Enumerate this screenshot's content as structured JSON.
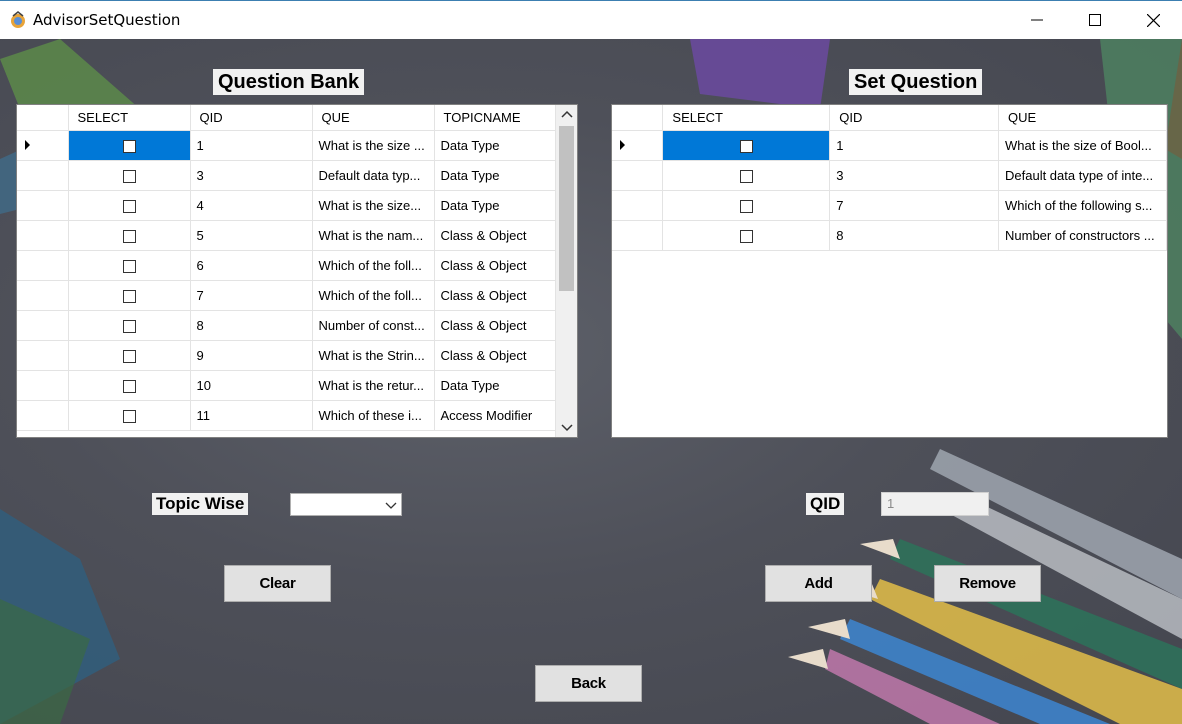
{
  "window": {
    "title": "AdvisorSetQuestion"
  },
  "question_bank": {
    "title": "Question Bank",
    "columns": [
      "SELECT",
      "QID",
      "QUE",
      "TOPICNAME"
    ],
    "rows": [
      {
        "qid": "1",
        "que": "What is the size ...",
        "topic": "Data Type"
      },
      {
        "qid": "3",
        "que": "Default data typ...",
        "topic": "Data Type"
      },
      {
        "qid": "4",
        "que": " What is the size...",
        "topic": "Data Type"
      },
      {
        "qid": "5",
        "que": "What is the nam...",
        "topic": "Class & Object"
      },
      {
        "qid": "6",
        "que": "Which of the foll...",
        "topic": "Class & Object"
      },
      {
        "qid": "7",
        "que": "Which of the foll...",
        "topic": "Class & Object"
      },
      {
        "qid": "8",
        "que": "Number of const...",
        "topic": "Class & Object"
      },
      {
        "qid": "9",
        "que": "What is the Strin...",
        "topic": "Class & Object"
      },
      {
        "qid": "10",
        "que": "What is the retur...",
        "topic": "Data Type"
      },
      {
        "qid": "11",
        "que": "Which of these i...",
        "topic": "Access Modifier"
      }
    ]
  },
  "set_question": {
    "title": "Set Question",
    "columns": [
      "SELECT",
      "QID",
      "QUE"
    ],
    "rows": [
      {
        "qid": "1",
        "que": "What is the size of Bool..."
      },
      {
        "qid": "3",
        "que": "Default data type of inte..."
      },
      {
        "qid": "7",
        "que": "Which of the following s..."
      },
      {
        "qid": "8",
        "que": "Number of constructors ..."
      }
    ]
  },
  "controls": {
    "topic_label": "Topic Wise",
    "topic_value": "",
    "qid_label": "QID",
    "qid_value": "1",
    "clear_label": "Clear",
    "add_label": "Add",
    "remove_label": "Remove",
    "back_label": "Back"
  },
  "colors": {
    "selection": "#0078d7",
    "button": "#e1e1e1",
    "background": "#4e5059"
  },
  "icons": [
    "app-icon",
    "minimize-icon",
    "maximize-icon",
    "close-icon",
    "row-indicator-icon",
    "scroll-up-icon",
    "scroll-down-icon",
    "dropdown-chevron-icon"
  ]
}
